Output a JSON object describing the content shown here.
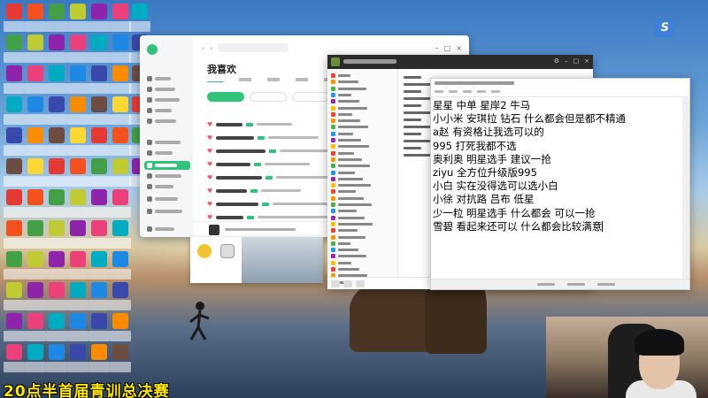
{
  "music_app": {
    "title": "我喜欢"
  },
  "notepad": {
    "lines": [
      "星星 中单 星岸2 牛马",
      "小小米 安琪拉 钻石 什么都会但是都不精通",
      "a赵 有资格让我选可以的",
      "995 打死我都不选",
      "奥利奥  明星选手 建议一抢",
      "ziyu  全方位升级版995",
      "小白 实在没得选可以选小白",
      "小徐 对抗路 吕布 低星",
      "少一粒 明星选手  什么都会 可以一抢",
      "雪碧 看起来还可以 什么都会比较满意"
    ]
  },
  "overlay": {
    "caption": "20点半首届青训总决赛"
  },
  "desktop": {
    "right_icon_letter": "S"
  },
  "colors": {
    "accent_green": "#31c27c",
    "caption_yellow": "#ffe600"
  }
}
